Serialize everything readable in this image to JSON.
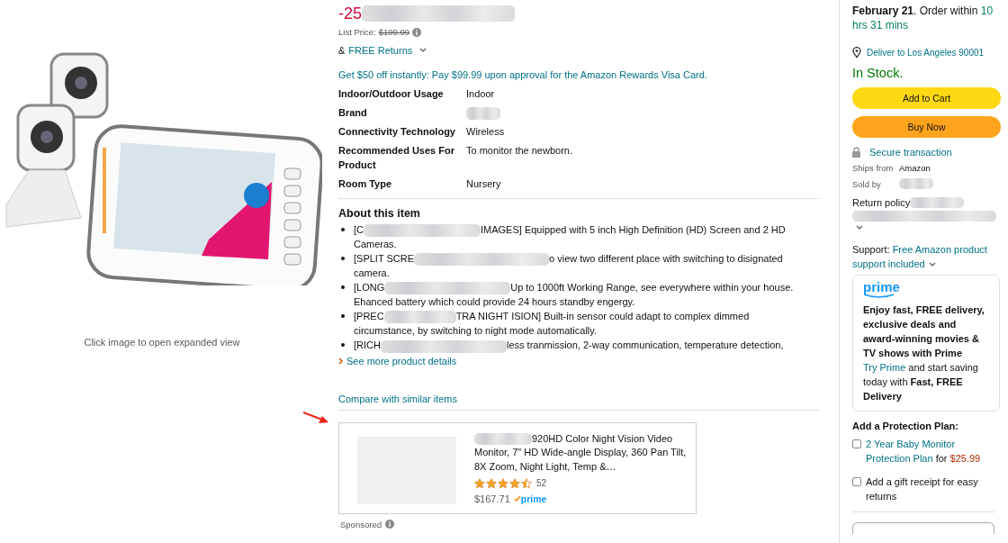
{
  "gallery": {
    "caption": "Click image to open expanded view"
  },
  "price": {
    "discount": "-25",
    "list_price_label": "List Price:",
    "list_price": "$199.99",
    "returns_prefix": "&",
    "returns_link": "FREE Returns"
  },
  "promo": "Get $50 off instantly: Pay $99.99 upon approval for the Amazon Rewards Visa Card.",
  "specs": [
    {
      "label": "Indoor/Outdoor Usage",
      "value": "Indoor"
    },
    {
      "label": "Brand"
    },
    {
      "label": "Connectivity Technology",
      "value": "Wireless"
    },
    {
      "label": "Recommended Uses For Product",
      "value": "To monitor the newborn."
    },
    {
      "label": "Room Type",
      "value": "Nursery"
    }
  ],
  "about": {
    "heading": "About this item",
    "bullets": [
      {
        "start": "[C",
        "end": "IMAGES] Equipped with 5 inch High Definition (HD) Screen and 2 HD Cameras."
      },
      {
        "start": "[SPLIT SCRE",
        "end": "o view two different place with switching to disignated camera."
      },
      {
        "start": "[LONG",
        "end": "Up to 1000ft Working Range, see everywhere within your house. Ehanced battery which could provide 24 hours standby engergy."
      },
      {
        "start": "[PREC",
        "end": "TRA NIGHT ISION] Built-in sensor could adapt to complex dimmed circumstance, by switching to night mode automatically."
      },
      {
        "start": "[RICH",
        "end": "less tranmission, 2-way communication, temperature detection,"
      }
    ],
    "see_more": "See more product details"
  },
  "compare": {
    "link": "Compare with similar items",
    "product": {
      "title": "920HD Color Night Vision Video Monitor, 7\" HD Wide-angle Display, 360 Pan Tilt, 8X Zoom, Night Light, Temp &…",
      "stars": 4.5,
      "reviews": "52",
      "price": "$167.71",
      "badge": "prime"
    },
    "sponsored": "Sponsored"
  },
  "buy_box": {
    "delivery_date": "February 21",
    "delivery_text": ". Order within ",
    "countdown": "10 hrs 31 mins",
    "deliver_to": "Deliver to Los Angeles 90001",
    "stock": "In Stock.",
    "buttons": [
      {
        "kind": "cart",
        "label": "Add to Cart"
      },
      {
        "kind": "buy",
        "label": "Buy Now"
      }
    ],
    "secure": "Secure transaction",
    "details": [
      {
        "label": "Ships from",
        "value": "Amazon"
      },
      {
        "label": "Sold by"
      }
    ],
    "return_policy": "Return policy",
    "support_label": "Support: ",
    "support_link": "Free Amazon product support included",
    "prime": {
      "logo": "prime",
      "pitch": "Enjoy fast, FREE delivery, exclusive deals and award-winning movies & TV shows with Prime",
      "link": "Try Prime",
      "rest": " and start saving today with **Fast, FREE Delivery**"
    },
    "protection": {
      "heading": "Add a Protection Plan:",
      "options": [
        {
          "checked": false,
          "link": "2 Year Baby Monitor Protection Plan",
          "for": " for ",
          "price": "$25.99"
        }
      ]
    },
    "gift": {
      "checked": false,
      "label": "Add a gift receipt for easy returns"
    }
  }
}
